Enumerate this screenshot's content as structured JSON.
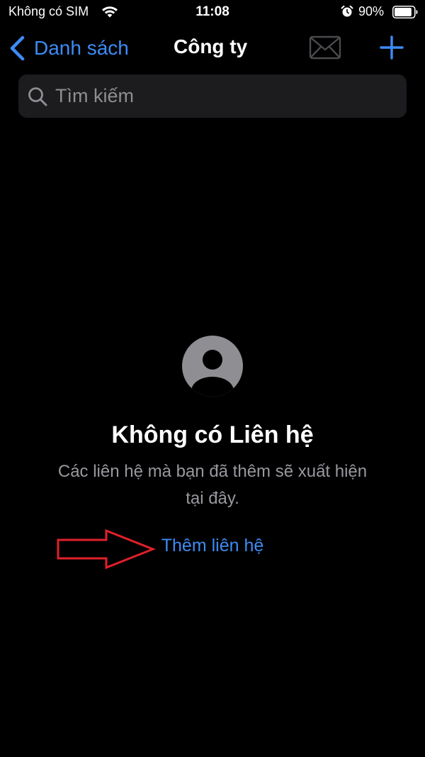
{
  "status_bar": {
    "carrier": "Không có SIM",
    "time": "11:08",
    "battery_percent": "90%",
    "battery_level": 0.9,
    "icons": [
      "wifi-icon",
      "alarm-icon",
      "battery-icon"
    ]
  },
  "nav": {
    "back_label": "Danh sách",
    "title": "Công ty",
    "icons": [
      "chevron-left-icon",
      "mail-icon",
      "plus-icon"
    ]
  },
  "search": {
    "placeholder": "Tìm kiếm",
    "value": ""
  },
  "empty_state": {
    "title": "Không có Liên hệ",
    "subtitle_line1": "Các liên hệ mà bạn đã thêm sẽ xuất hiện",
    "subtitle_line2": "tại đây.",
    "action_label": "Thêm liên hệ",
    "icon": "person-circle-icon"
  },
  "annotation": {
    "icon": "red-arrow-icon"
  },
  "colors": {
    "background": "#000000",
    "accent": "#3d8bf5",
    "search_bg": "#1c1c1e",
    "secondary_text": "#98989f",
    "annotation": "#e0202a",
    "avatar_bg": "#8e8e93"
  }
}
